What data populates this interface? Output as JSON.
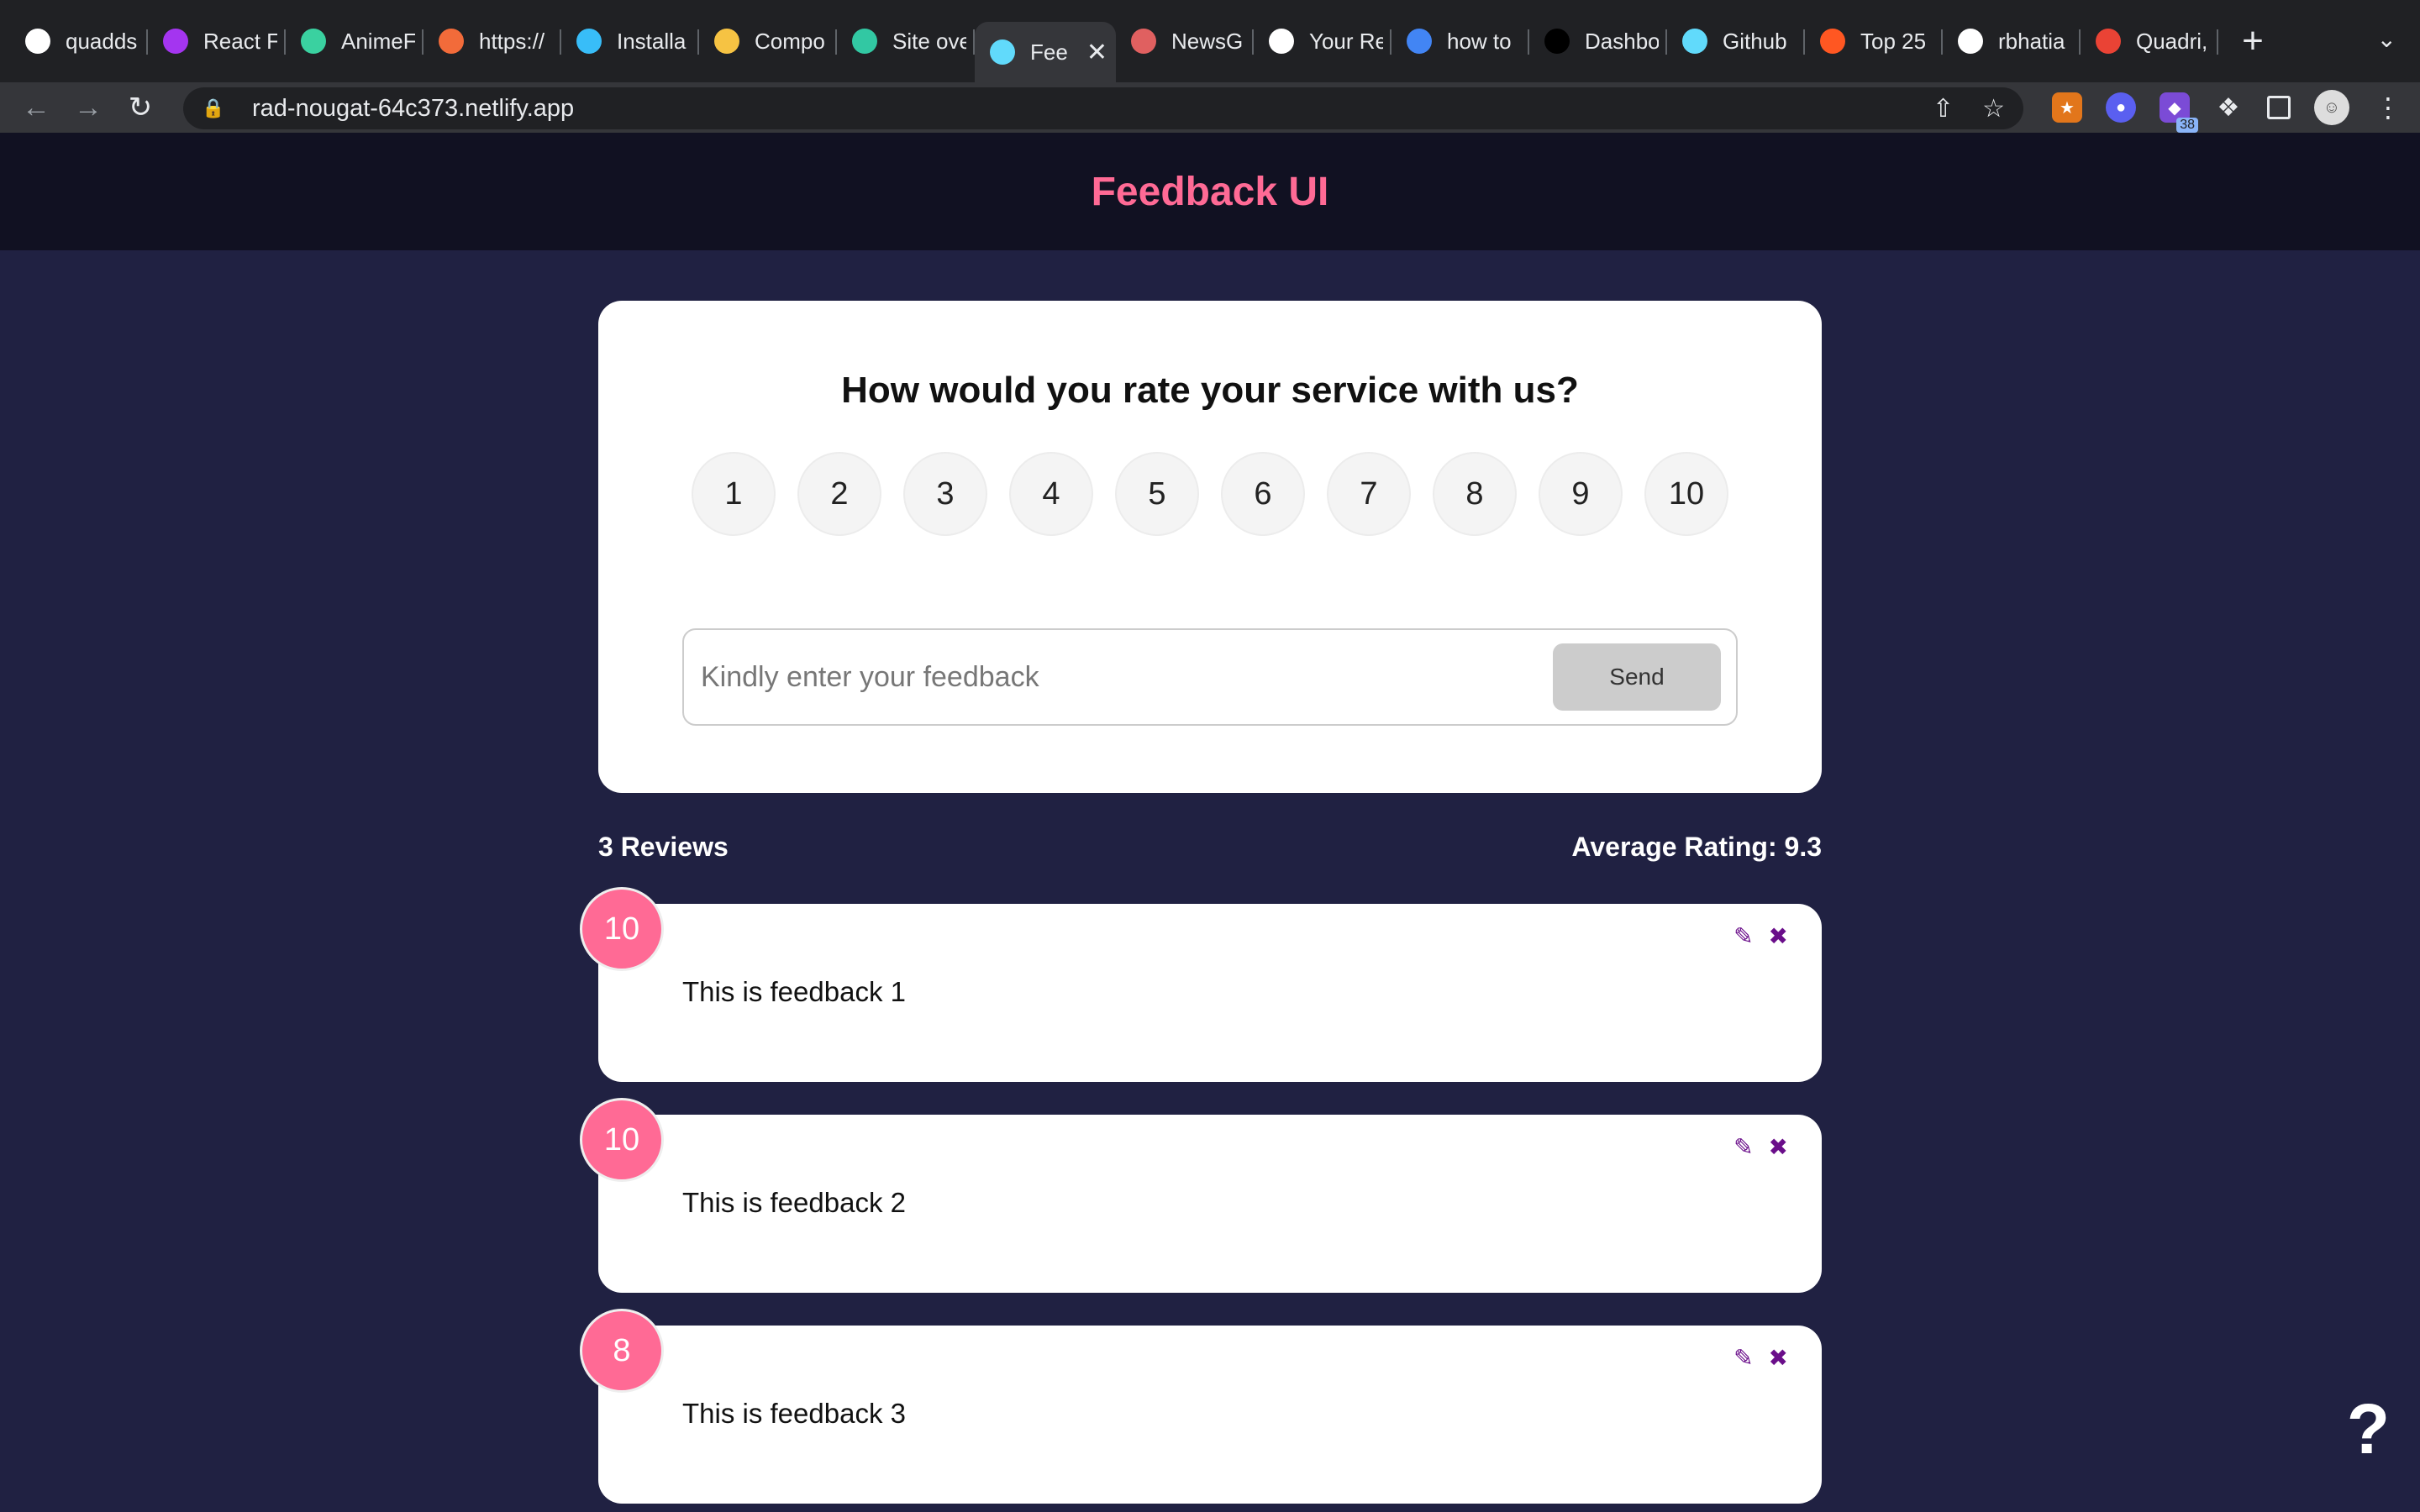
{
  "browser": {
    "tabs": [
      {
        "title": "quadds",
        "icon": "github-icon",
        "color": "#ffffff"
      },
      {
        "title": "React F",
        "icon": "udemy-icon",
        "color": "#a435f0"
      },
      {
        "title": "AnimeF",
        "icon": "k-icon",
        "color": "#3ad1a0"
      },
      {
        "title": "https://",
        "icon": "flutter-icon",
        "color": "#f26b3a"
      },
      {
        "title": "Installa",
        "icon": "tailwind-icon",
        "color": "#38bdf8"
      },
      {
        "title": "Compo",
        "icon": "flower-icon",
        "color": "#f6c343"
      },
      {
        "title": "Site ove",
        "icon": "netlify-icon",
        "color": "#32c8a3"
      },
      {
        "title": "Fee",
        "icon": "react-icon",
        "color": "#61dafb"
      },
      {
        "title": "NewsG",
        "icon": "react-icon",
        "color": "#e06060"
      },
      {
        "title": "Your Re",
        "icon": "github-icon",
        "color": "#ffffff"
      },
      {
        "title": "how to",
        "icon": "google-icon",
        "color": "#4285f4"
      },
      {
        "title": "Dashbo",
        "icon": "vercel-icon",
        "color": "#000000"
      },
      {
        "title": "Github",
        "icon": "react-icon",
        "color": "#61dafb"
      },
      {
        "title": "Top 25",
        "icon": "jira-icon",
        "color": "#ff5722"
      },
      {
        "title": "rbhatia",
        "icon": "github-icon",
        "color": "#ffffff"
      },
      {
        "title": "Quadri,",
        "icon": "gmail-icon",
        "color": "#ea4335"
      }
    ],
    "url": "rad-nougat-64c373.netlify.app",
    "extension_badge": "38"
  },
  "app": {
    "title": "Feedback UI",
    "question": "How would you rate your service with us?",
    "ratings": [
      "1",
      "2",
      "3",
      "4",
      "5",
      "6",
      "7",
      "8",
      "9",
      "10"
    ],
    "input_placeholder": "Kindly enter your feedback",
    "send_label": "Send",
    "reviews_count": "3 Reviews",
    "average": "Average Rating: 9.3",
    "reviews": [
      {
        "rating": "10",
        "text": "This is feedback 1"
      },
      {
        "rating": "10",
        "text": "This is feedback 2"
      },
      {
        "rating": "8",
        "text": "This is feedback 3"
      }
    ],
    "help": "?",
    "colors": {
      "accent": "#ff6a95",
      "background": "#202142",
      "header": "#111122"
    }
  }
}
